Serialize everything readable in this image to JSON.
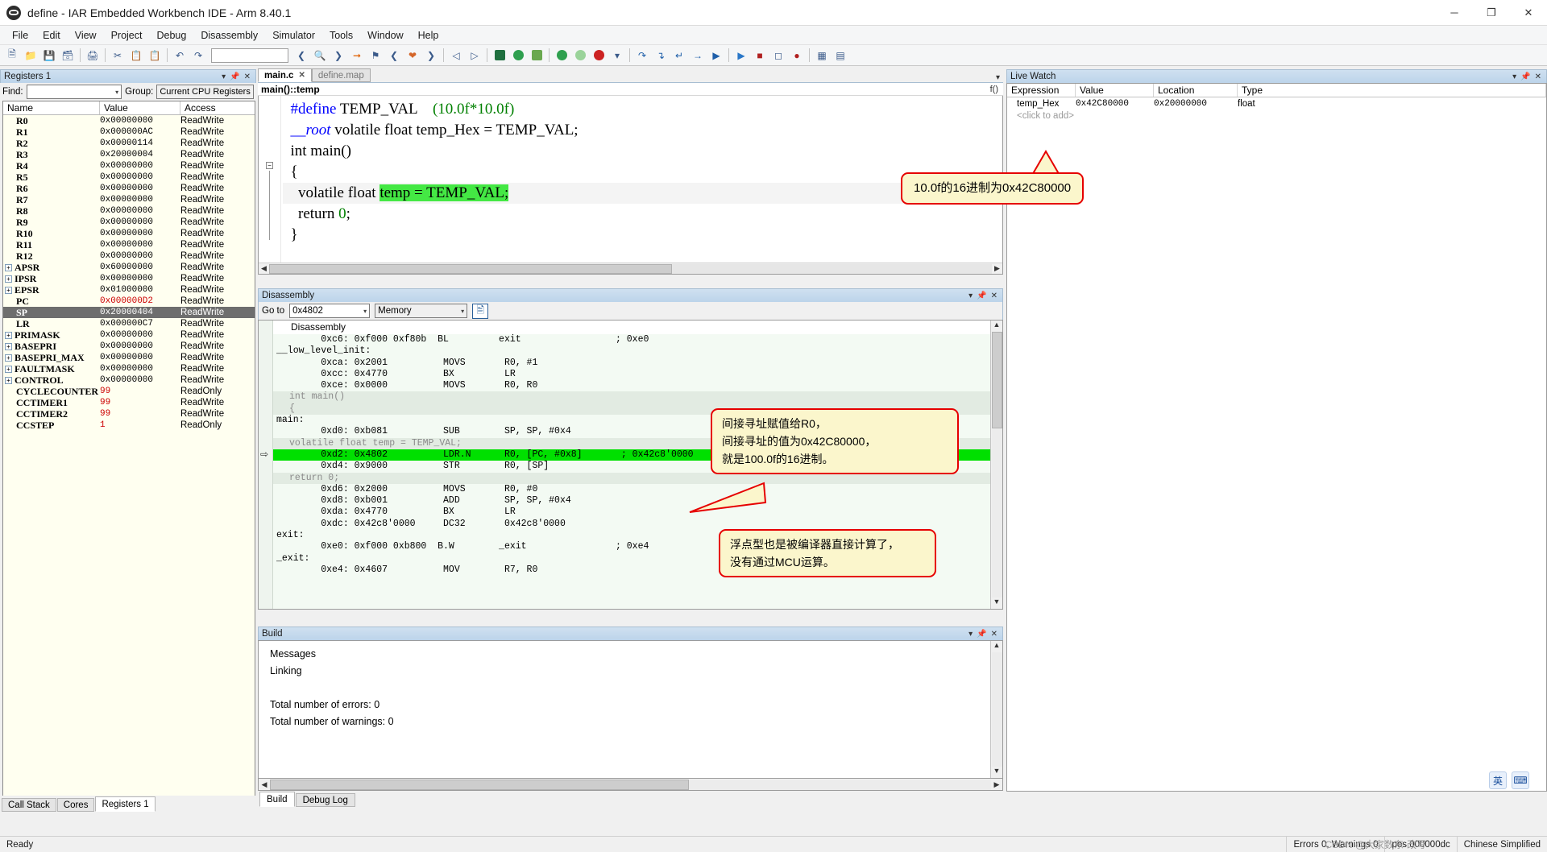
{
  "window": {
    "title": "define - IAR Embedded Workbench IDE - Arm 8.40.1",
    "minimize": "─",
    "maximize": "❐",
    "close": "✕"
  },
  "menubar": [
    "File",
    "Edit",
    "View",
    "Project",
    "Debug",
    "Disassembly",
    "Simulator",
    "Tools",
    "Window",
    "Help"
  ],
  "registers_panel": {
    "title": "Registers 1",
    "find_label": "Find:",
    "find_value": "",
    "group_label": "Group:",
    "group_value": "Current CPU Registers",
    "columns": [
      "Name",
      "Value",
      "Access"
    ],
    "rows": [
      {
        "name": "R0",
        "value": "0x00000000",
        "access": "ReadWrite",
        "expandable": false
      },
      {
        "name": "R1",
        "value": "0x000000AC",
        "access": "ReadWrite",
        "expandable": false
      },
      {
        "name": "R2",
        "value": "0x00000114",
        "access": "ReadWrite",
        "expandable": false
      },
      {
        "name": "R3",
        "value": "0x20000004",
        "access": "ReadWrite",
        "expandable": false
      },
      {
        "name": "R4",
        "value": "0x00000000",
        "access": "ReadWrite",
        "expandable": false
      },
      {
        "name": "R5",
        "value": "0x00000000",
        "access": "ReadWrite",
        "expandable": false
      },
      {
        "name": "R6",
        "value": "0x00000000",
        "access": "ReadWrite",
        "expandable": false
      },
      {
        "name": "R7",
        "value": "0x00000000",
        "access": "ReadWrite",
        "expandable": false
      },
      {
        "name": "R8",
        "value": "0x00000000",
        "access": "ReadWrite",
        "expandable": false
      },
      {
        "name": "R9",
        "value": "0x00000000",
        "access": "ReadWrite",
        "expandable": false
      },
      {
        "name": "R10",
        "value": "0x00000000",
        "access": "ReadWrite",
        "expandable": false
      },
      {
        "name": "R11",
        "value": "0x00000000",
        "access": "ReadWrite",
        "expandable": false
      },
      {
        "name": "R12",
        "value": "0x00000000",
        "access": "ReadWrite",
        "expandable": false
      },
      {
        "name": "APSR",
        "value": "0x60000000",
        "access": "ReadWrite",
        "expandable": true
      },
      {
        "name": "IPSR",
        "value": "0x00000000",
        "access": "ReadWrite",
        "expandable": true
      },
      {
        "name": "EPSR",
        "value": "0x01000000",
        "access": "ReadWrite",
        "expandable": true
      },
      {
        "name": "PC",
        "value": "0x000000D2",
        "access": "ReadWrite",
        "expandable": false,
        "value_red": true
      },
      {
        "name": "SP",
        "value": "0x20000404",
        "access": "ReadWrite",
        "expandable": false,
        "selected": true
      },
      {
        "name": "LR",
        "value": "0x000000C7",
        "access": "ReadWrite",
        "expandable": false
      },
      {
        "name": "PRIMASK",
        "value": "0x00000000",
        "access": "ReadWrite",
        "expandable": true
      },
      {
        "name": "BASEPRI",
        "value": "0x00000000",
        "access": "ReadWrite",
        "expandable": true
      },
      {
        "name": "BASEPRI_MAX",
        "value": "0x00000000",
        "access": "ReadWrite",
        "expandable": true
      },
      {
        "name": "FAULTMASK",
        "value": "0x00000000",
        "access": "ReadWrite",
        "expandable": true
      },
      {
        "name": "CONTROL",
        "value": "0x00000000",
        "access": "ReadWrite",
        "expandable": true
      },
      {
        "name": "CYCLECOUNTER",
        "value": "99",
        "access": "ReadOnly",
        "expandable": false,
        "value_red": true
      },
      {
        "name": "CCTIMER1",
        "value": "99",
        "access": "ReadWrite",
        "expandable": false,
        "value_red": true
      },
      {
        "name": "CCTIMER2",
        "value": "99",
        "access": "ReadWrite",
        "expandable": false,
        "value_red": true
      },
      {
        "name": "CCSTEP",
        "value": "1",
        "access": "ReadOnly",
        "expandable": false,
        "value_red": true
      }
    ]
  },
  "left_dock_tabs": [
    {
      "label": "Call Stack",
      "active": false
    },
    {
      "label": "Cores",
      "active": false
    },
    {
      "label": "Registers 1",
      "active": true
    }
  ],
  "editor": {
    "tabs": [
      {
        "label": "main.c",
        "active": true,
        "close": "✕"
      },
      {
        "label": "define.map",
        "active": false
      }
    ],
    "breadcrumb": "main()::temp",
    "fx_icon": "f()",
    "code_lines": [
      {
        "segments": [
          {
            "text": "  ",
            "style": "plain"
          },
          {
            "text": "#define",
            "style": "k-blue"
          },
          {
            "text": " TEMP_VAL    ",
            "style": "plain"
          },
          {
            "text": "(10.0f*10.0f)",
            "style": "k-green"
          }
        ]
      },
      {
        "segments": [
          {
            "text": "  __",
            "style": "k-ital"
          },
          {
            "text": "root",
            "style": "k-ital"
          },
          {
            "text": " volatile float temp_Hex = TEMP_VAL;",
            "style": "plain"
          }
        ]
      },
      {
        "segments": [
          {
            "text": "  int main()",
            "style": "plain"
          }
        ]
      },
      {
        "segments": [
          {
            "text": "  {",
            "style": "plain"
          }
        ]
      },
      {
        "segments": [
          {
            "text": "    volatile float ",
            "style": "plain"
          },
          {
            "text": "temp = TEMP_VAL;",
            "style": "hl-green"
          }
        ],
        "shaded": true
      },
      {
        "segments": [
          {
            "text": "    return ",
            "style": "plain"
          },
          {
            "text": "0",
            "style": "k-green"
          },
          {
            "text": ";",
            "style": "plain"
          }
        ]
      },
      {
        "segments": [
          {
            "text": "  }",
            "style": "plain"
          }
        ]
      }
    ]
  },
  "disassembly": {
    "title": "Disassembly",
    "goto_label": "Go to",
    "goto_value": "0x4802",
    "memory_value": "Memory",
    "column_header": "Disassembly",
    "lines": [
      {
        "kind": "code",
        "text": "        0xc6: 0xf000 0xf80b  BL         exit                 ; 0xe0"
      },
      {
        "kind": "label",
        "text": "__low_level_init:"
      },
      {
        "kind": "code",
        "text": "        0xca: 0x2001          MOVS       R0, #1"
      },
      {
        "kind": "code",
        "text": "        0xcc: 0x4770          BX         LR"
      },
      {
        "kind": "code",
        "text": "        0xce: 0x0000          MOVS       R0, R0"
      },
      {
        "kind": "src",
        "text": "int main()"
      },
      {
        "kind": "src",
        "text": "{"
      },
      {
        "kind": "label",
        "text": "main:"
      },
      {
        "kind": "code",
        "text": "        0xd0: 0xb081          SUB        SP, SP, #0x4"
      },
      {
        "kind": "src",
        "text": "volatile float temp = TEMP_VAL;"
      },
      {
        "kind": "current",
        "text": "        0xd2: 0x4802          LDR.N      R0, [PC, #0x8]       ; 0x42c8'0000"
      },
      {
        "kind": "code",
        "text": "        0xd4: 0x9000          STR        R0, [SP]"
      },
      {
        "kind": "src",
        "text": "return 0;"
      },
      {
        "kind": "code",
        "text": "        0xd6: 0x2000          MOVS       R0, #0"
      },
      {
        "kind": "code",
        "text": "        0xd8: 0xb001          ADD        SP, SP, #0x4"
      },
      {
        "kind": "code",
        "text": "        0xda: 0x4770          BX         LR"
      },
      {
        "kind": "code",
        "text": "        0xdc: 0x42c8'0000     DC32       0x42c8'0000"
      },
      {
        "kind": "label",
        "text": "exit:"
      },
      {
        "kind": "code",
        "text": "        0xe0: 0xf000 0xb800  B.W        _exit                ; 0xe4"
      },
      {
        "kind": "label",
        "text": "_exit:"
      },
      {
        "kind": "code",
        "text": "        0xe4: 0x4607          MOV        R7, R0"
      }
    ]
  },
  "build_panel": {
    "title": "Build",
    "lines": [
      "Messages",
      "Linking",
      "",
      "Total number of errors: 0",
      "Total number of warnings: 0"
    ],
    "tabs": [
      {
        "label": "Build",
        "active": true
      },
      {
        "label": "Debug Log",
        "active": false
      }
    ]
  },
  "live_watch": {
    "title": "Live Watch",
    "columns": [
      "Expression",
      "Value",
      "Location",
      "Type"
    ],
    "rows": [
      {
        "expression": "temp_Hex",
        "value": "0x42C80000",
        "location": "0x20000000",
        "type": "float"
      },
      {
        "expression": "<click to add>",
        "value": "",
        "location": "",
        "type": "",
        "placeholder": true
      }
    ]
  },
  "callouts": [
    {
      "id": "callout-hex-value",
      "lines": [
        "10.0f的16进制为0x42C80000"
      ]
    },
    {
      "id": "callout-indirect-addressing",
      "lines": [
        "间接寻址赋值给R0，",
        "间接寻址的值为0x42C80000，",
        "就是100.0f的16进制。"
      ]
    },
    {
      "id": "callout-float-computed",
      "lines": [
        "浮点型也是被编译器直接计算了，",
        "没有通过MCU运算。"
      ]
    }
  ],
  "statusbar": {
    "ready": "Ready",
    "errors": "Errors 0, Warnings 0",
    "pos": "pos 000000dc",
    "ime": "Chinese Simplified",
    "ln": "",
    "caps": ""
  },
  "ime_widget": {
    "lang": "英",
    "tool": "⌨"
  },
  "watermark": "CSDN @大家数东·改写"
}
